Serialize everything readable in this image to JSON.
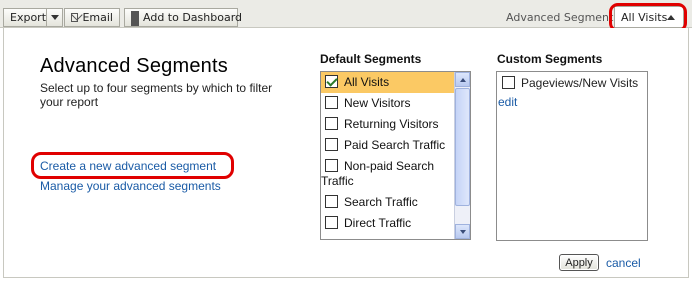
{
  "toolbar": {
    "export_label": "Export",
    "email_label": "Email",
    "dashboard_label": "Add to Dashboard",
    "advanced_segments_label": "Advanced Segments",
    "segment_selector_value": "All Visits"
  },
  "intro": {
    "title": "Advanced Segments",
    "subtitle": "Select up to four segments by which to filter your report",
    "create_link": "Create a new advanced segment",
    "manage_link": "Manage your advanced segments"
  },
  "default_segments": {
    "heading": "Default Segments",
    "items": [
      {
        "label": "All Visits",
        "checked": true,
        "selected": true
      },
      {
        "label": "New Visitors",
        "checked": false
      },
      {
        "label": "Returning Visitors",
        "checked": false
      },
      {
        "label": "Paid Search Traffic",
        "checked": false
      },
      {
        "label": "Non-paid Search Traffic",
        "checked": false
      },
      {
        "label": "Search Traffic",
        "checked": false
      },
      {
        "label": "Direct Traffic",
        "checked": false
      }
    ]
  },
  "custom_segments": {
    "heading": "Custom Segments",
    "items": [
      {
        "label": "Pageviews/New Visits",
        "checked": false,
        "edit_label": "edit"
      }
    ]
  },
  "actions": {
    "apply_label": "Apply",
    "cancel_label": "cancel"
  },
  "colors": {
    "highlight_annotation": "#e00000",
    "link": "#1a5ba6",
    "selected_row": "#fbc964"
  },
  "icons": [
    "chevron-down-icon",
    "envelope-icon",
    "dashboard-grid-icon",
    "chevron-up-icon",
    "checkmark-icon",
    "scroll-up-icon",
    "scroll-down-icon"
  ]
}
